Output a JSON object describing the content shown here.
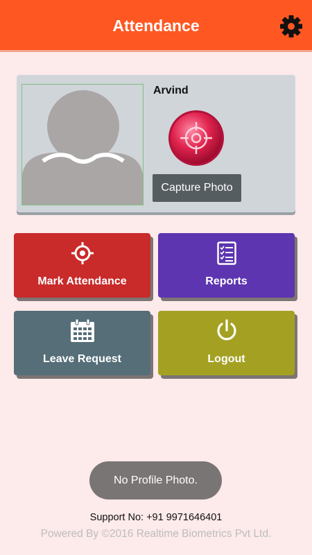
{
  "app_bar": {
    "title": "Attendance",
    "settings_icon": "gear-icon",
    "color": "#ff5722"
  },
  "profile": {
    "name": "Arvind",
    "avatar_icon": "person-silhouette-icon",
    "capture_icon": "crosshair-target-icon",
    "capture_label": "Capture Photo"
  },
  "tiles": [
    {
      "label": "Mark Attendance",
      "icon": "crosshair-icon",
      "color": "#c92a2a"
    },
    {
      "label": "Reports",
      "icon": "checklist-icon",
      "color": "#5d35b0"
    },
    {
      "label": "Leave Request",
      "icon": "calendar-icon",
      "color": "#556e78"
    },
    {
      "label": "Logout",
      "icon": "power-icon",
      "color": "#a4a122"
    }
  ],
  "toast": {
    "message": "No Profile Photo."
  },
  "footer": {
    "support": "Support No: +91 9971646401",
    "powered_by": "Powered By ©2016 Realtime Biometrics Pvt Ltd."
  }
}
